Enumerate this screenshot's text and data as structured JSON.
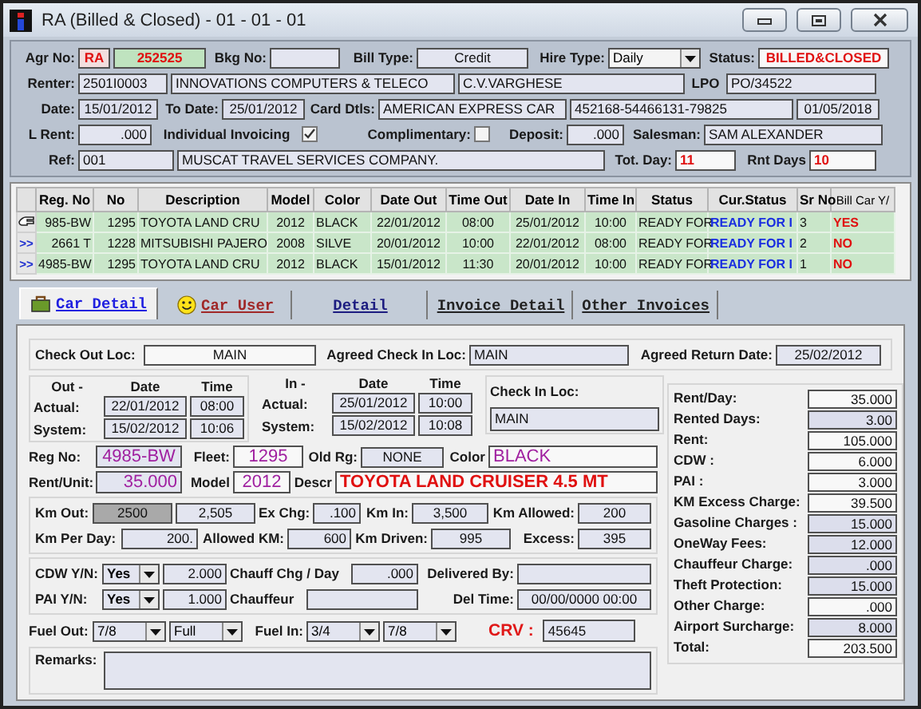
{
  "window": {
    "title": "RA (Billed & Closed) - 01 - 01 - 01"
  },
  "header": {
    "agr_no": {
      "label": "Agr No:",
      "prefix": "RA",
      "number": "252525"
    },
    "bkg_no": {
      "label": "Bkg No:"
    },
    "bill_type": {
      "label": "Bill Type:",
      "value": "Credit"
    },
    "hire_type": {
      "label": "Hire Type:",
      "value": "Daily"
    },
    "status": {
      "label": "Status:",
      "value": "BILLED&CLOSED"
    },
    "renter": {
      "label": "Renter:",
      "code": "2501I0003",
      "company": "INNOVATIONS COMPUTERS & TELECO",
      "contact": "C.V.VARGHESE"
    },
    "lpo": {
      "label": "LPO",
      "value": "PO/34522"
    },
    "date": {
      "label": "Date:",
      "value": "15/01/2012"
    },
    "to_date": {
      "label": "To Date:",
      "value": "25/01/2012"
    },
    "card": {
      "label": "Card Dtls:",
      "type": "AMERICAN EXPRESS CAR",
      "number": "452168-54466131-79825",
      "expiry": "01/05/2018"
    },
    "l_rent": {
      "label": "L Rent:",
      "value": ".000"
    },
    "individual_invoicing": {
      "label": "Individual Invoicing",
      "checked": true
    },
    "complimentary": {
      "label": "Complimentary:",
      "checked": false
    },
    "deposit": {
      "label": "Deposit:",
      "value": ".000"
    },
    "salesman": {
      "label": "Salesman:",
      "value": "SAM ALEXANDER"
    },
    "ref": {
      "label": "Ref:",
      "code": "001",
      "name": "MUSCAT TRAVEL SERVICES COMPANY."
    },
    "tot_day": {
      "label": "Tot. Day:",
      "value": "11"
    },
    "rnt_days": {
      "label": "Rnt Days",
      "value": "10"
    }
  },
  "table": {
    "columns": [
      "Reg. No",
      "No",
      "Description",
      "Model",
      "Color",
      "Date Out",
      "Time Out",
      "Date In",
      "Time In",
      "Status",
      "Cur.Status",
      "Sr No",
      "Bill Car Y/"
    ],
    "rows": [
      {
        "selected": true,
        "cells": [
          "985-BW",
          "1295",
          "TOYOTA LAND CRU",
          "2012",
          "BLACK",
          "22/01/2012",
          "08:00",
          "25/01/2012",
          "10:00",
          "READY FOR",
          "READY FOR I",
          "3",
          "YES"
        ]
      },
      {
        "selected": false,
        "marker": ">>",
        "cells": [
          "2661 T",
          "1228",
          "MITSUBISHI PAJERO",
          "2008",
          "SILVE",
          "20/01/2012",
          "10:00",
          "22/01/2012",
          "08:00",
          "READY FOR",
          "READY FOR I",
          "2",
          "NO"
        ]
      },
      {
        "selected": false,
        "marker": ">>",
        "cells": [
          "4985-BW",
          "1295",
          "TOYOTA LAND CRU",
          "2012",
          "BLACK",
          "15/01/2012",
          "11:30",
          "20/01/2012",
          "10:00",
          "READY FOR",
          "READY FOR I",
          "1",
          "NO"
        ]
      }
    ]
  },
  "tabs": [
    {
      "label": "Car Detail",
      "selected": true,
      "color": "#2020e0"
    },
    {
      "label": "Car User",
      "selected": false,
      "color": "#a02828"
    },
    {
      "label": "Detail",
      "selected": false,
      "color": "#1c1c80"
    },
    {
      "label": "Invoice Detail",
      "selected": false,
      "color": "#222222"
    },
    {
      "label": "Other Invoices",
      "selected": false,
      "color": "#222222"
    }
  ],
  "car_detail": {
    "check_out_loc": {
      "label": "Check Out Loc:",
      "value": "MAIN"
    },
    "agreed_check_in_loc": {
      "label": "Agreed Check In Loc:",
      "value": "MAIN"
    },
    "agreed_return_date": {
      "label": "Agreed Return Date:",
      "value": "25/02/2012"
    },
    "out": {
      "title": "Out -",
      "date_heading": "Date",
      "time_heading": "Time",
      "rows": [
        {
          "label": "Actual:",
          "date": "22/01/2012",
          "time": "08:00"
        },
        {
          "label": "System:",
          "date": "15/02/2012",
          "time": "10:06"
        }
      ]
    },
    "in": {
      "title": "In -",
      "date_heading": "Date",
      "time_heading": "Time",
      "rows": [
        {
          "label": "Actual:",
          "date": "25/01/2012",
          "time": "10:00"
        },
        {
          "label": "System:",
          "date": "15/02/2012",
          "time": "10:08"
        }
      ]
    },
    "check_in_loc": {
      "label": "Check In Loc:",
      "value": "MAIN"
    },
    "reg_no": {
      "label": "Reg No:",
      "value": "4985-BW"
    },
    "fleet": {
      "label": "Fleet:",
      "value": "1295"
    },
    "old_rg": {
      "label": "Old Rg:",
      "value": "NONE"
    },
    "color": {
      "label": "Color",
      "value": "BLACK"
    },
    "rent_unit": {
      "label": "Rent/Unit:",
      "value": "35.000"
    },
    "model": {
      "label": "Model",
      "value": "2012"
    },
    "descr": {
      "label": "Descr",
      "value": "TOYOTA LAND CRUISER 4.5 MT"
    },
    "km_out": {
      "label": "Km Out:",
      "value": "2500",
      "value_2": "2,505"
    },
    "ex_chg": {
      "label": "Ex Chg:",
      "value": ".100"
    },
    "km_in": {
      "label": "Km In:",
      "value": "3,500"
    },
    "km_allowed": {
      "label": "Km Allowed:",
      "value": "200"
    },
    "km_per_day": {
      "label": "Km Per Day:",
      "value": "200."
    },
    "allowed_km": {
      "label": "Allowed KM:",
      "value": "600"
    },
    "km_driven": {
      "label": "Km Driven:",
      "value": "995"
    },
    "excess": {
      "label": "Excess:",
      "value": "395"
    },
    "cdw": {
      "label": "CDW Y/N:",
      "choice": "Yes",
      "amount": "2.000"
    },
    "pai": {
      "label": "PAI Y/N:",
      "choice": "Yes",
      "amount": "1.000"
    },
    "chauff_chg": {
      "label": "Chauff Chg / Day",
      "value": ".000"
    },
    "chauffeur": {
      "label": "Chauffeur"
    },
    "delivered_by": {
      "label": "Delivered By:"
    },
    "del_time": {
      "label": "Del Time:",
      "value": "00/00/0000 00:00"
    },
    "fuel_out": {
      "label": "Fuel Out:",
      "level_value": "7/8",
      "state": "Full"
    },
    "fuel_in": {
      "label": "Fuel In:",
      "level_value": "3/4",
      "state": "7/8"
    },
    "crv": {
      "label": "CRV :",
      "value": "45645"
    },
    "remarks": {
      "label": "Remarks:"
    }
  },
  "charges": [
    {
      "label": "Rent/Day:",
      "value": "35.000",
      "shaded": false
    },
    {
      "label": "Rented Days:",
      "value": "3.00",
      "shaded": true
    },
    {
      "label": "Rent:",
      "value": "105.000",
      "shaded": false
    },
    {
      "label": "CDW :",
      "value": "6.000",
      "shaded": false
    },
    {
      "label": "PAI :",
      "value": "3.000",
      "shaded": false
    },
    {
      "label": "KM Excess Charge:",
      "value": "39.500",
      "shaded": false
    },
    {
      "label": "Gasoline Charges :",
      "value": "15.000",
      "shaded": true
    },
    {
      "label": "OneWay Fees:",
      "value": "12.000",
      "shaded": true
    },
    {
      "label": "Chauffeur Charge:",
      "value": ".000",
      "shaded": true
    },
    {
      "label": "Theft Protection:",
      "value": "15.000",
      "shaded": true
    },
    {
      "label": "Other Charge:",
      "value": ".000",
      "shaded": false
    },
    {
      "label": "Airport Surcharge:",
      "value": "8.000",
      "shaded": true
    },
    {
      "label": "Total:",
      "value": "203.500",
      "shaded": false
    }
  ]
}
